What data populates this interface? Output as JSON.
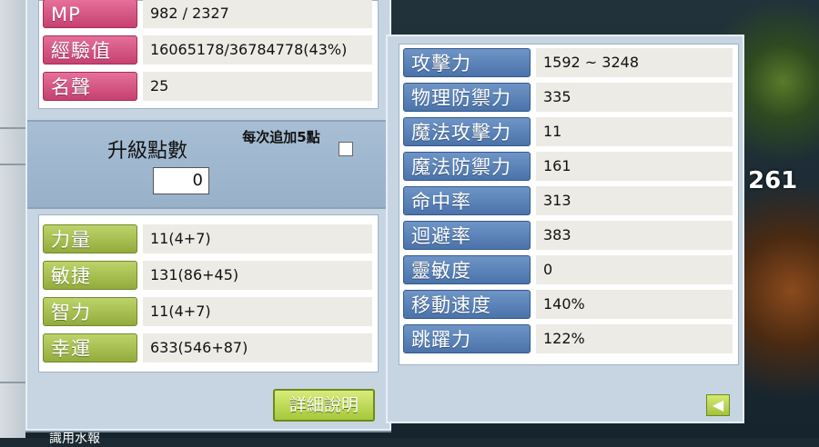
{
  "stats": {
    "mp": {
      "label": "MP",
      "value": "982 / 2327"
    },
    "exp": {
      "label": "經驗值",
      "value": "16065178/36784778(43%)"
    },
    "fame": {
      "label": "名聲",
      "value": "25"
    }
  },
  "level_up": {
    "label": "升級點數",
    "points": "0",
    "each_label": "每次追加5點"
  },
  "attributes": [
    {
      "label": "力量",
      "value": "11(4+7)"
    },
    {
      "label": "敏捷",
      "value": "131(86+45)"
    },
    {
      "label": "智力",
      "value": "11(4+7)"
    },
    {
      "label": "幸運",
      "value": "633(546+87)"
    }
  ],
  "detail_button": "詳細說明",
  "detail_stats": [
    {
      "label": "攻擊力",
      "value": "1592 ~ 3248"
    },
    {
      "label": "物理防禦力",
      "value": "335"
    },
    {
      "label": "魔法攻擊力",
      "value": "11"
    },
    {
      "label": "魔法防禦力",
      "value": "161"
    },
    {
      "label": "命中率",
      "value": "313"
    },
    {
      "label": "迴避率",
      "value": "383"
    },
    {
      "label": "靈敏度",
      "value": "0"
    },
    {
      "label": "移動速度",
      "value": "140%"
    },
    {
      "label": "跳躍力",
      "value": "122%"
    }
  ],
  "back_button": "◀",
  "side_number": "261",
  "bottom_text": "識用水報"
}
